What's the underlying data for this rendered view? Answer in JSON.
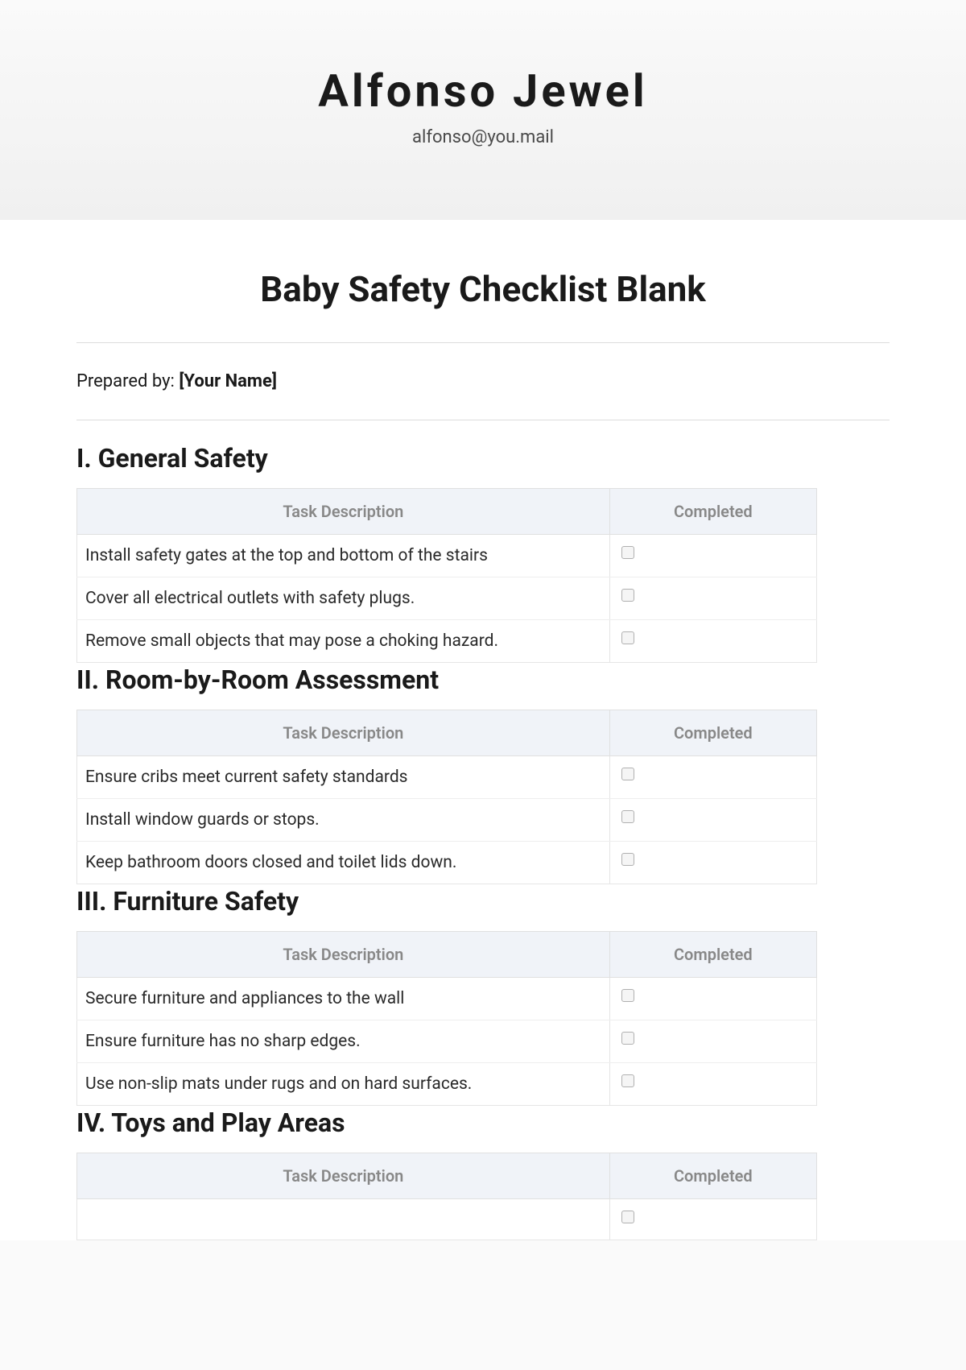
{
  "header": {
    "name": "Alfonso Jewel",
    "email": "alfonso@you.mail"
  },
  "document": {
    "title": "Baby Safety Checklist Blank",
    "preparedByLabel": "Prepared by: ",
    "preparedByValue": "[Your Name]"
  },
  "tableHeaders": {
    "taskDescription": "Task Description",
    "completed": "Completed"
  },
  "sections": [
    {
      "heading": "I. General Safety",
      "tasks": [
        "Install safety gates at the top and bottom of the stairs",
        "Cover all electrical outlets with safety plugs.",
        "Remove small objects that may pose a choking hazard."
      ]
    },
    {
      "heading": "II. Room-by-Room Assessment",
      "tasks": [
        "Ensure cribs meet current safety standards",
        "Install window guards or stops.",
        "Keep bathroom doors closed and toilet lids down."
      ]
    },
    {
      "heading": "III. Furniture Safety",
      "tasks": [
        "Secure furniture and appliances to the wall",
        "Ensure furniture has no sharp edges.",
        "Use non-slip mats under rugs and on hard surfaces."
      ]
    },
    {
      "heading": "IV. Toys and Play Areas",
      "tasks": []
    }
  ]
}
